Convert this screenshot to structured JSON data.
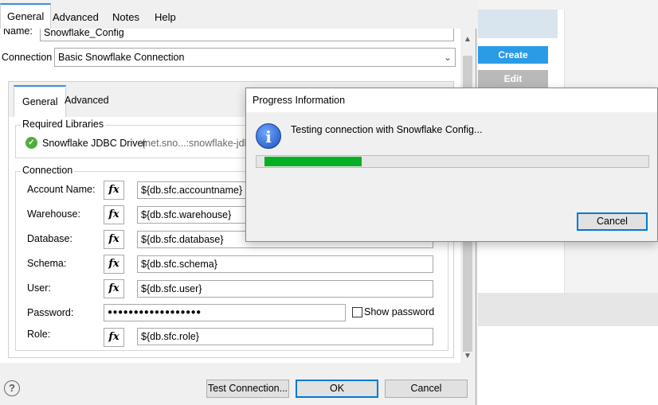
{
  "background_app": {
    "create_label": "Create",
    "edit_label": "Edit",
    "create_color": "#2a9be6"
  },
  "dialog": {
    "tabs": [
      {
        "label": "General",
        "active": true
      },
      {
        "label": "Advanced"
      },
      {
        "label": "Notes"
      },
      {
        "label": "Help"
      }
    ],
    "name_label": "Name:",
    "name_value": "Snowflake_Config",
    "connection_label": "Connection",
    "connection_value": "Basic Snowflake Connection",
    "inner_tabs": [
      {
        "label": "General",
        "active": true
      },
      {
        "label": "Advanced"
      }
    ],
    "required_libraries": {
      "title": "Required Libraries",
      "item_label": "Snowflake JDBC Driver",
      "item_detail": "(net.sno...:snowflake-jdbc"
    },
    "connection_group": {
      "title": "Connection",
      "fx_label": "fx",
      "fields": {
        "account_name": {
          "label": "Account Name:",
          "value": "${db.sfc.accountname}"
        },
        "warehouse": {
          "label": "Warehouse:",
          "value": "${db.sfc.warehouse}"
        },
        "database": {
          "label": "Database:",
          "value": "${db.sfc.database}"
        },
        "schema": {
          "label": "Schema:",
          "value": "${db.sfc.schema}"
        },
        "user": {
          "label": "User:",
          "value": "${db.sfc.user}"
        },
        "password": {
          "label": "Password:",
          "value": "●●●●●●●●●●●●●●●●●●"
        },
        "role": {
          "label": "Role:",
          "value": "${db.sfc.role}"
        }
      },
      "show_password_label": "Show password",
      "show_password_checked": false
    },
    "buttons": {
      "test_connection": "Test Connection...",
      "ok": "OK",
      "cancel": "Cancel"
    },
    "help_glyph": "?"
  },
  "progress_dialog": {
    "title": "Progress Information",
    "message": "Testing connection with Snowflake Config...",
    "info_glyph": "i",
    "progress_fraction": 0.26,
    "progress_color": "#06b025",
    "cancel_label": "Cancel"
  }
}
